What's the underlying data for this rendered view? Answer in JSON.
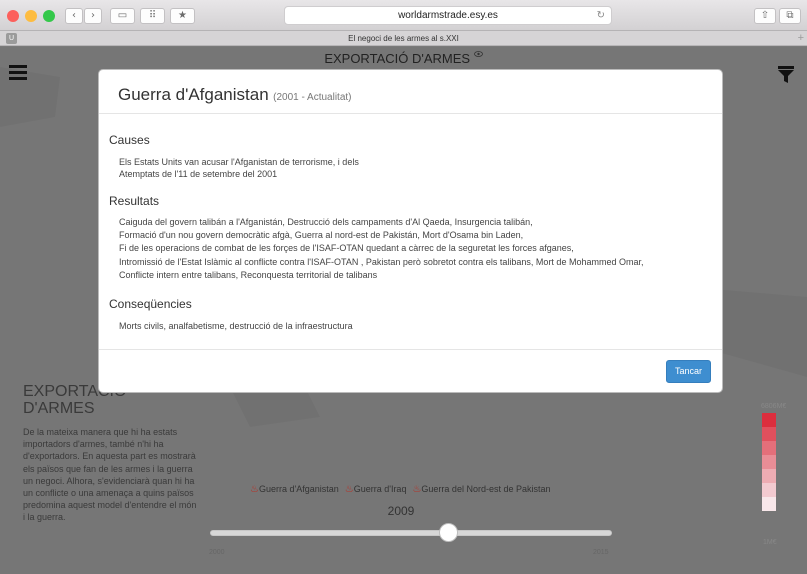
{
  "browser": {
    "url": "worldarmstrade.esy.es",
    "tab_title": "El negoci de les armes al s.XXI",
    "tab_icon_letter": "U",
    "new_tab": "+",
    "reload_icon": "reload-icon",
    "buttons": [
      "back",
      "forward",
      "sidebar",
      "top-sites",
      "bookmark",
      "share",
      "tabs"
    ]
  },
  "page": {
    "title": "EXPORTACIÓ D'ARMES",
    "title_icon": "eye-icon",
    "side_title": "EXPORTACIÓ D'ARMES",
    "side_text": "De la mateixa manera que hi ha estats importadors d'armes, també n'hi ha d'exportadors. En aquesta part es mostrarà els països que fan de les armes i la guerra un negoci. Alhora, s'evidenciarà quan hi ha un conflicte o una amenaça a quins països predomina aquest model d'entendre el món i la guerra.",
    "wars": [
      "Guerra d'Afganistan",
      "Guerra d'Iraq",
      "Guerra del Nord-est de Pakistan"
    ],
    "year": "2009",
    "slider": {
      "min": "2000",
      "max": "2015",
      "value": 2009
    },
    "legend": {
      "max": "6806M€",
      "min": "1M€",
      "colors": [
        "#dc2e3d",
        "#e0505d",
        "#e46f7a",
        "#e98d96",
        "#eeacb3",
        "#f3cad0",
        "#f8e7ea"
      ]
    }
  },
  "modal": {
    "title": "Guerra d'Afganistan",
    "dates": "(2001 - Actualitat)",
    "causes_heading": "Causes",
    "causes": [
      "Els Estats Units van acusar l'Afganistan de terrorisme, i dels",
      "Atemptats de l'11 de setembre del 2001"
    ],
    "results_heading": "Resultats",
    "results": [
      "Caiguda del govern talibán a l'Afganistán,   Destrucció dels campaments d'Al Qaeda,   Insurgencia talibán,",
      "Formació d'un nou govern democràtic afgà,   Guerra al nord-est de Pakistán,   Mort d'Osama bin Laden,",
      "Fi de les operacions de combat de les forçes de l'ISAF-OTAN quedant a càrrec de la seguretat les forces afganes,",
      "Intromissió de l'Estat Islàmic al conflicte contra l'ISAF-OTAN , Pakistan però sobretot contra els talibans,   Mort de Mohammed Omar,",
      "Conflicte intern entre talibans,   Reconquesta territorial de talibans"
    ],
    "consequences_heading": "Conseqüencies",
    "consequences": [
      "Morts civils,   analfabetisme,   destrucció de la infraestructura"
    ],
    "close_label": "Tancar"
  }
}
